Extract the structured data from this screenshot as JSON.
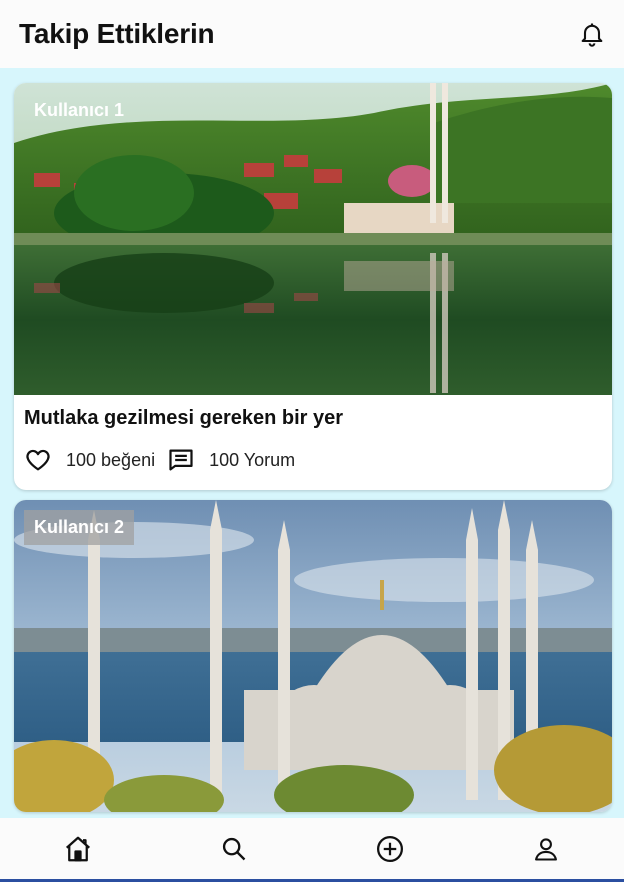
{
  "header": {
    "title": "Takip Ettiklerin",
    "notification_icon": "bell-icon"
  },
  "posts": [
    {
      "user": "Kullanıcı 1",
      "image": "lakeside-mosque-photo",
      "caption": "Mutlaka gezilmesi gereken bir yer",
      "likes": "100 beğeni",
      "comments": "100 Yorum"
    },
    {
      "user": "Kullanıcı 2",
      "image": "blue-mosque-photo",
      "caption": "",
      "likes": "",
      "comments": ""
    }
  ],
  "nav": [
    {
      "icon": "home-icon"
    },
    {
      "icon": "search-icon"
    },
    {
      "icon": "add-circle-icon"
    },
    {
      "icon": "profile-icon"
    }
  ],
  "colors": {
    "background": "#d7f6fc",
    "bar": "#fbfbfb",
    "nav_underline": "#2b4fa0"
  }
}
